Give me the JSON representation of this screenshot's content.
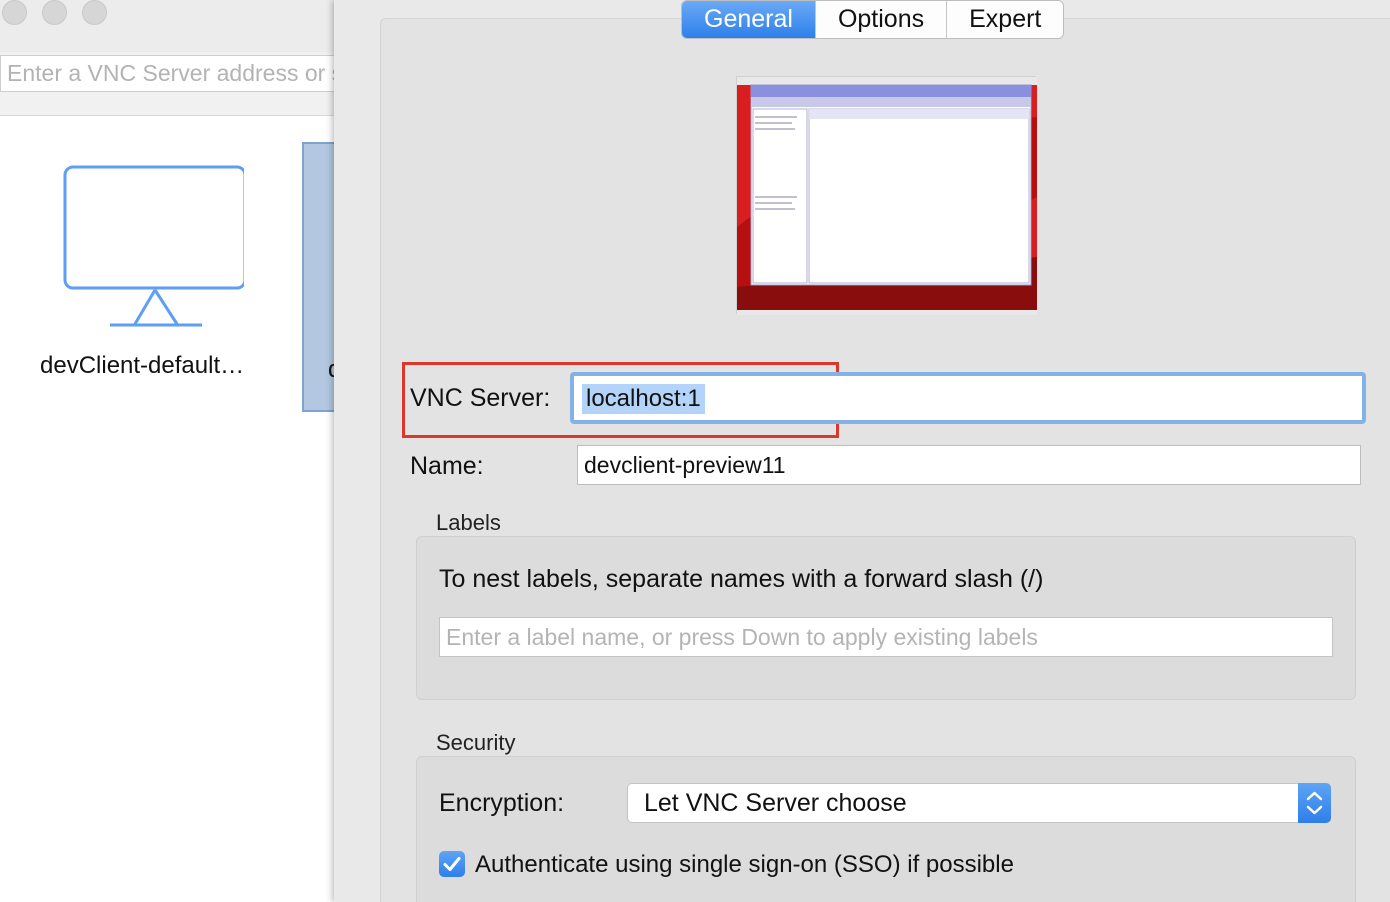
{
  "left_window": {
    "address_placeholder": "Enter a VNC Server address or search",
    "computer_tile_label": "devClient-default…",
    "partial_tile_letter": "d"
  },
  "tabs": [
    {
      "label": "General",
      "active": true
    },
    {
      "label": "Options",
      "active": false
    },
    {
      "label": "Expert",
      "active": false
    }
  ],
  "form": {
    "vnc_server_label": "VNC Server:",
    "vnc_server_value": "localhost:1",
    "name_label": "Name:",
    "name_value": "devclient-preview11"
  },
  "labels_group": {
    "title": "Labels",
    "hint": "To nest labels, separate names with a forward slash (/)",
    "input_placeholder": "Enter a label name, or press Down to apply existing labels"
  },
  "security_group": {
    "title": "Security",
    "encryption_label": "Encryption:",
    "encryption_value": "Let VNC Server choose",
    "sso_checkbox_label": "Authenticate using single sign-on (SSO) if possible",
    "sso_checked": true
  },
  "colors": {
    "accent_blue": "#2f7fe9",
    "highlight_red": "#d9382a",
    "selection_blue": "#b4d3f8"
  }
}
